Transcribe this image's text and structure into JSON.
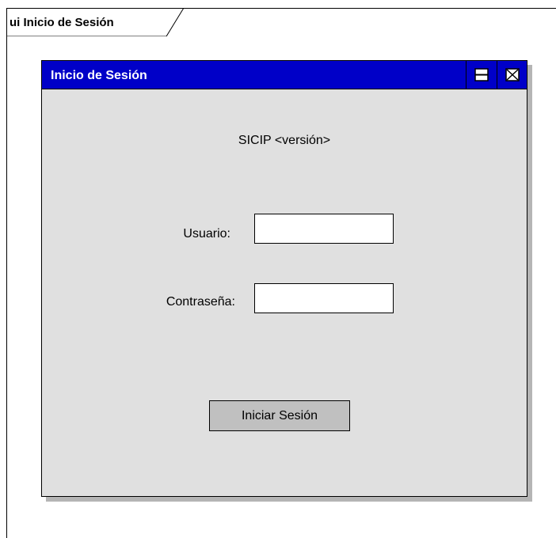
{
  "frame": {
    "title": "ui Inicio de Sesión"
  },
  "window": {
    "title": "Inicio de Sesión",
    "titlebar_color": "#0000c8",
    "body_color": "#e0e0e0",
    "buttons": {
      "maximize_icon": "window-maximize-icon",
      "close_icon": "window-close-icon"
    }
  },
  "app": {
    "version_text": "SICIP <versión>"
  },
  "form": {
    "username_label": "Usuario:",
    "username_value": "",
    "password_label": "Contraseña:",
    "password_value": "",
    "submit_label": "Iniciar Sesión"
  }
}
